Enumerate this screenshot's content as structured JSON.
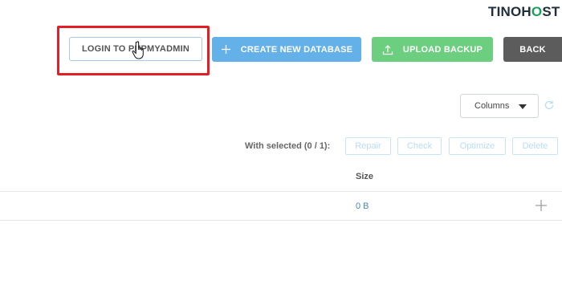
{
  "logo": {
    "part1": "TINO",
    "part2": "H",
    "part3": "O",
    "part4": "ST"
  },
  "toolbar": {
    "login_label": "LOGIN TO PHPMYADMIN",
    "create_label": "CREATE NEW DATABASE",
    "upload_label": "UPLOAD BACKUP",
    "back_label": "BACK",
    "create_icon": "plus-icon",
    "upload_icon": "upload-icon"
  },
  "columns": {
    "label": "Columns"
  },
  "selection": {
    "label": "With selected (0 / 1):",
    "actions": [
      "Repair",
      "Check",
      "Optimize",
      "Delete"
    ]
  },
  "table": {
    "headers": [
      "Size"
    ],
    "rows": [
      {
        "size": "0 B"
      }
    ]
  },
  "colors": {
    "create": "#64b0e8",
    "upload": "#6ccf7f",
    "back": "#5c5c5c",
    "highlight": "#e41e26",
    "brand_green": "#1aa05a"
  }
}
